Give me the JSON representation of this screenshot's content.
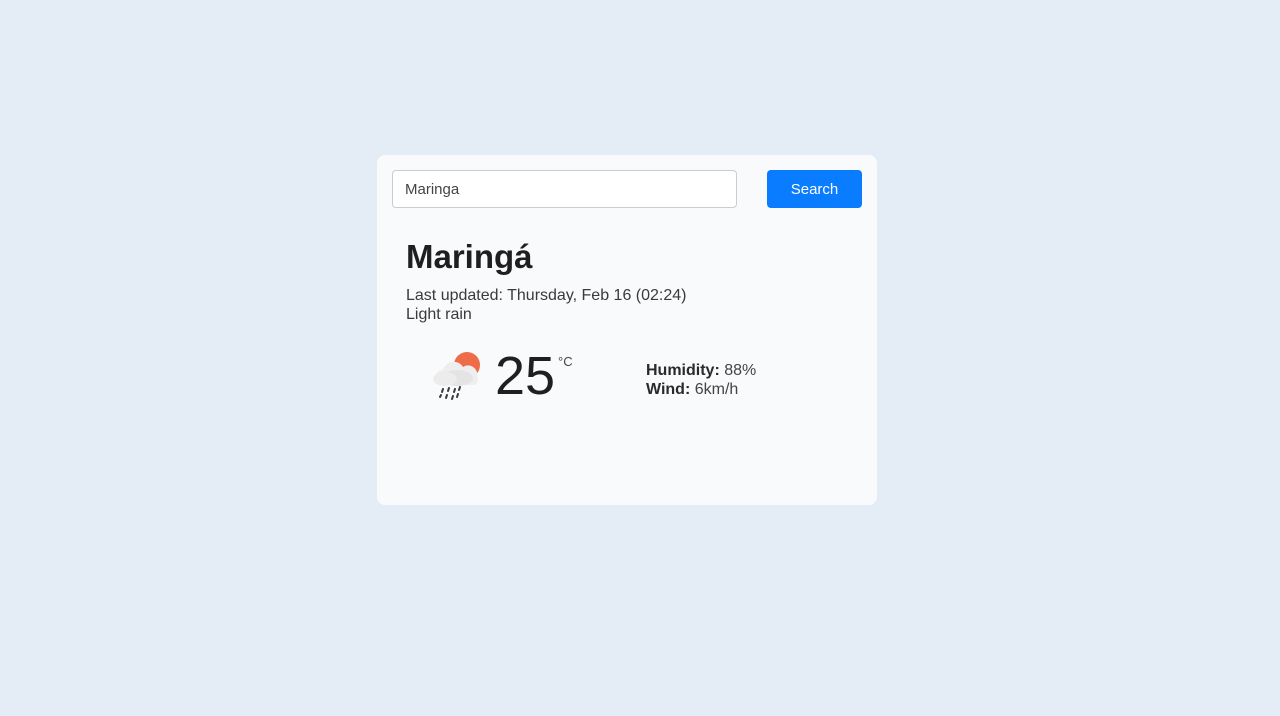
{
  "search": {
    "value": "Maringa",
    "button_label": "Search"
  },
  "weather": {
    "city": "Maringá",
    "last_updated": "Last updated: Thursday, Feb 16 (02:24)",
    "condition": "Light rain",
    "icon": "rain-cloud-sun-icon",
    "temperature": "25",
    "unit": "°C",
    "humidity_label": "Humidity:",
    "humidity_value": "88%",
    "wind_label": "Wind:",
    "wind_value": "6km/h"
  },
  "colors": {
    "page_background": "#e4ecf5",
    "card_background": "#f8fafc",
    "accent": "#0a7cff",
    "sun": "#ef6c48"
  }
}
